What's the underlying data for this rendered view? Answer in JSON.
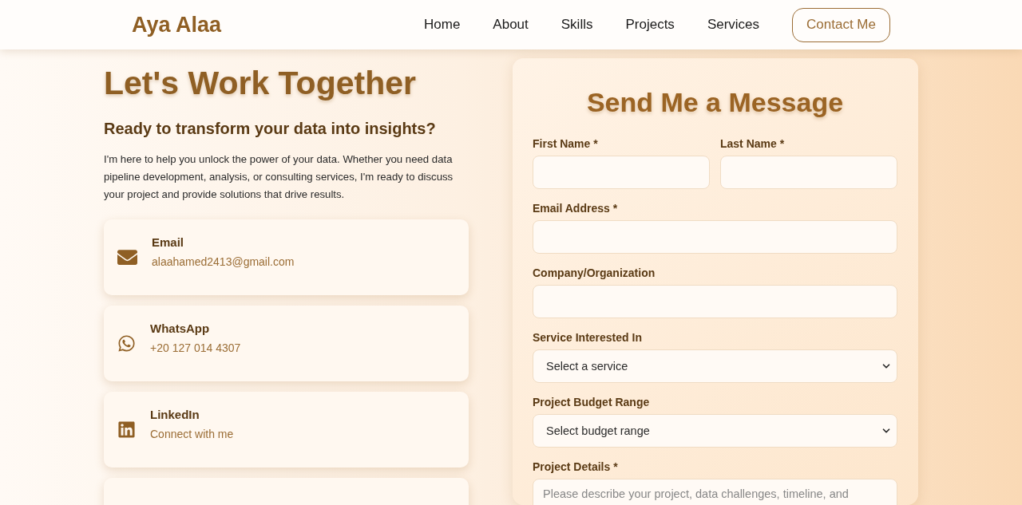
{
  "header": {
    "logo": "Aya Alaa",
    "nav": [
      {
        "label": "Home"
      },
      {
        "label": "About"
      },
      {
        "label": "Skills"
      },
      {
        "label": "Projects"
      },
      {
        "label": "Services"
      }
    ],
    "cta": "Contact Me"
  },
  "intro": {
    "title": "Let's Work Together",
    "subtitle": "Ready to transform your data into insights?",
    "body": "I'm here to help you unlock the power of your data. Whether you need data pipeline development, analysis, or consulting services, I'm ready to discuss your project and provide solutions that drive results."
  },
  "contacts": [
    {
      "kind": "email",
      "label": "Email",
      "value": "alaahamed2413@gmail.com"
    },
    {
      "kind": "whatsapp",
      "label": "WhatsApp",
      "value": "+20 127 014 4307"
    },
    {
      "kind": "linkedin",
      "label": "LinkedIn",
      "value": "Connect with me"
    }
  ],
  "form": {
    "title": "Send Me a Message",
    "rows": [
      [
        {
          "kind": "text",
          "label": "First Name *"
        },
        {
          "kind": "text",
          "label": "Last Name *"
        }
      ],
      [
        {
          "kind": "text",
          "label": "Email Address *"
        }
      ],
      [
        {
          "kind": "text",
          "label": "Company/Organization"
        }
      ],
      [
        {
          "kind": "select",
          "label": "Service Interested In",
          "value": "Select a service"
        }
      ],
      [
        {
          "kind": "select",
          "label": "Project Budget Range",
          "value": "Select budget range"
        }
      ],
      [
        {
          "kind": "textarea",
          "label": "Project Details *",
          "placeholder": "Please describe your project, data challenges, timeline, and"
        }
      ]
    ]
  }
}
